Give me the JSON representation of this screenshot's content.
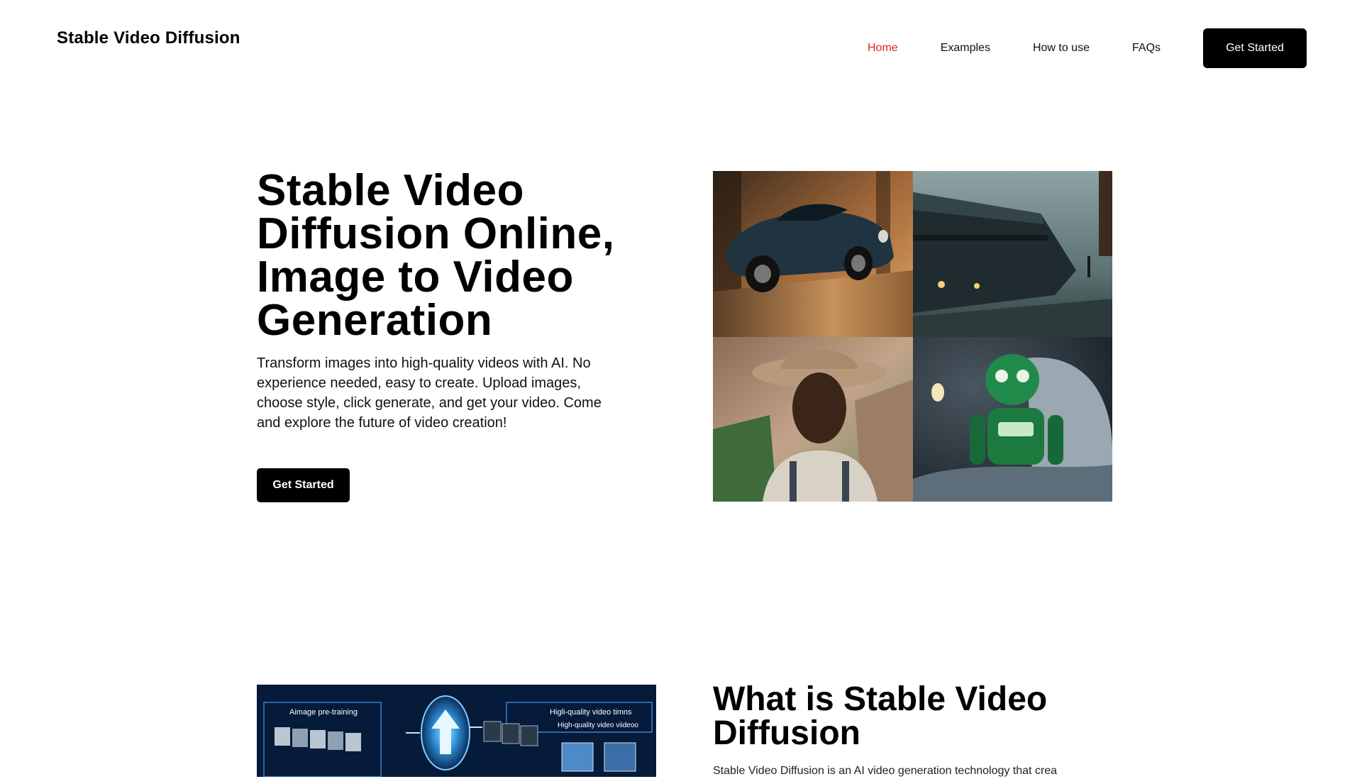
{
  "header": {
    "brand": "Stable Video Diffusion",
    "nav": [
      {
        "label": "Home",
        "active": true
      },
      {
        "label": "Examples",
        "active": false
      },
      {
        "label": "How to use",
        "active": false
      },
      {
        "label": "FAQs",
        "active": false
      }
    ],
    "cta_label": "Get Started"
  },
  "hero": {
    "title": "Stable Video Diffusion Online, Image to Video Generation",
    "description": "Transform images into high-quality videos with AI. No experience needed, easy to create. Upload images, choose style, click generate, and get your video. Come and explore the future of video creation!",
    "button_label": "Get Started",
    "images": [
      "vintage-car-photo",
      "rainy-train-photo",
      "cowboy-portrait-photo",
      "green-robot-bed-photo"
    ]
  },
  "section2": {
    "title": "What is Stable Video Diffusion",
    "subtitle": "Stable Video Diffusion is an AI video generation technology that crea",
    "diagram_labels": {
      "left": "Aimage pre-training",
      "right_top": "Higli-quality video timns",
      "right_bottom": "High-quality video viideoo"
    }
  },
  "colors": {
    "accent_active_nav": "#d9292b",
    "button_bg": "#000000",
    "diagram_bg": "#061a3a"
  }
}
